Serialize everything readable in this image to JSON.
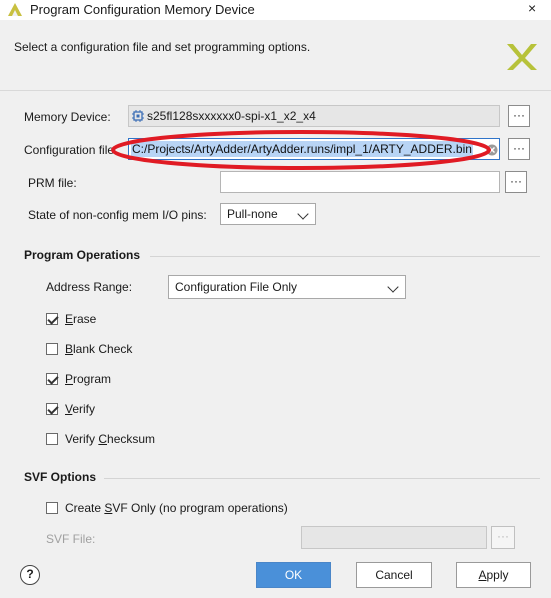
{
  "window": {
    "title": "Program Configuration Memory Device",
    "close_glyph": "×"
  },
  "header": {
    "subtitle": "Select a configuration file and set programming options."
  },
  "form": {
    "memory_device": {
      "label": "Memory Device:",
      "value": "s25fl128sxxxxxx0-spi-x1_x2_x4"
    },
    "config_file": {
      "label": "Configuration file:",
      "value": "C:/Projects/ArtyAdder/ArtyAdder.runs/impl_1/ARTY_ADDER.bin"
    },
    "prm_file": {
      "label": "PRM file:",
      "value": ""
    },
    "state_pins": {
      "label": "State of non-config mem I/O pins:",
      "value": "Pull-none"
    },
    "browse_glyph": "···"
  },
  "program_operations": {
    "heading": "Program Operations",
    "address_range": {
      "label": "Address Range:",
      "value": "Configuration File Only"
    },
    "options": [
      {
        "pre": "",
        "ul": "E",
        "post": "rase",
        "checked": true
      },
      {
        "pre": "",
        "ul": "B",
        "post": "lank Check",
        "checked": false
      },
      {
        "pre": "",
        "ul": "P",
        "post": "rogram",
        "checked": true
      },
      {
        "pre": "",
        "ul": "V",
        "post": "erify",
        "checked": true
      },
      {
        "pre": "Verify ",
        "ul": "C",
        "post": "hecksum",
        "checked": false
      }
    ]
  },
  "svf_options": {
    "heading": "SVF Options",
    "create_svf": {
      "pre": "Create ",
      "ul": "S",
      "post": "VF Only (no program operations)",
      "checked": false
    },
    "svf_file": {
      "label": "SVF File:",
      "value": ""
    }
  },
  "footer": {
    "help_glyph": "?",
    "ok": "OK",
    "cancel": "Cancel",
    "apply_pre": "",
    "apply_ul": "A",
    "apply_post": "pply"
  },
  "colors": {
    "highlight_ellipse": "#e01b24",
    "primary_button": "#4a90d9",
    "logo": "#b5c23a"
  }
}
